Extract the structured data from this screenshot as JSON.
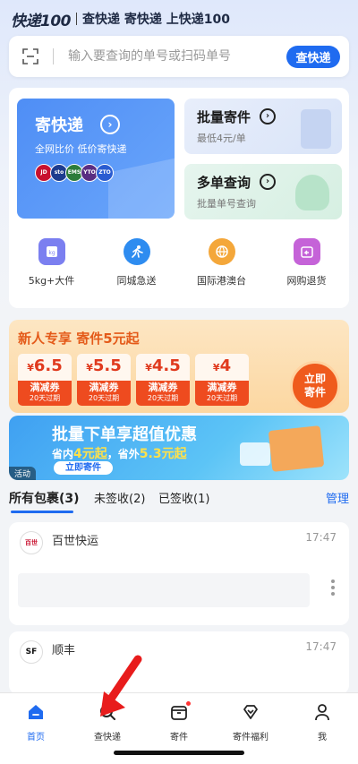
{
  "header": {
    "logo": "快递100",
    "slogan": "查快递 寄快递 上快递100"
  },
  "search": {
    "placeholder": "输入要查询的单号或扫码单号",
    "button": "查快递"
  },
  "services": {
    "send": {
      "title": "寄快递",
      "subtitle": "全网比价 低价寄快递",
      "carrier_logos": [
        "JD",
        "sto",
        "EMS",
        "YTO",
        "ZTO"
      ]
    },
    "bulk": {
      "title": "批量寄件",
      "subtitle": "最低4元/单"
    },
    "multi": {
      "title": "多单查询",
      "subtitle": "批量单号查询"
    },
    "icons": [
      {
        "label": "5kg+大件",
        "icon": "scale-icon"
      },
      {
        "label": "同城急送",
        "icon": "runner-icon"
      },
      {
        "label": "国际港澳台",
        "icon": "globe-icon"
      },
      {
        "label": "网购退货",
        "icon": "return-icon"
      }
    ]
  },
  "promo": {
    "title": "新人专享 寄件5元起",
    "coupons": [
      {
        "currency": "¥",
        "amount": "6.5",
        "type": "满减券",
        "expiry": "20天过期"
      },
      {
        "currency": "¥",
        "amount": "5.5",
        "type": "满减券",
        "expiry": "20天过期"
      },
      {
        "currency": "¥",
        "amount": "4.5",
        "type": "满减券",
        "expiry": "20天过期"
      },
      {
        "currency": "¥",
        "amount": "4",
        "type": "满减券",
        "expiry": "20天过期"
      }
    ],
    "cta_line1": "立即",
    "cta_line2": "寄件"
  },
  "banner": {
    "title": "批量下单享超值优惠",
    "sub_a": "省内",
    "sub_b": "4元起",
    "sub_c": "，省外",
    "sub_d": "5.3元起",
    "button": "立即寄件",
    "tag": "活动"
  },
  "packages": {
    "tabs": [
      {
        "label": "所有包裹(3)",
        "active": true
      },
      {
        "label": "未签收(2)",
        "active": false
      },
      {
        "label": "已签收(1)",
        "active": false
      }
    ],
    "manage": "管理",
    "items": [
      {
        "carrier": "百世快运",
        "logo_text": "百世",
        "time": "17:47"
      },
      {
        "carrier": "顺丰",
        "logo_text": "SF",
        "time": "17:47"
      }
    ]
  },
  "nav": [
    {
      "label": "首页",
      "icon": "home-icon",
      "active": true
    },
    {
      "label": "查快递",
      "icon": "search-icon",
      "active": false
    },
    {
      "label": "寄件",
      "icon": "box-icon",
      "active": false
    },
    {
      "label": "寄件福利",
      "icon": "gift-icon",
      "active": false
    },
    {
      "label": "我",
      "icon": "user-icon",
      "active": false
    }
  ],
  "colors": {
    "primary": "#1f6bf0",
    "promo_red": "#ee4b1f",
    "arrow_red": "#e81c1c"
  }
}
